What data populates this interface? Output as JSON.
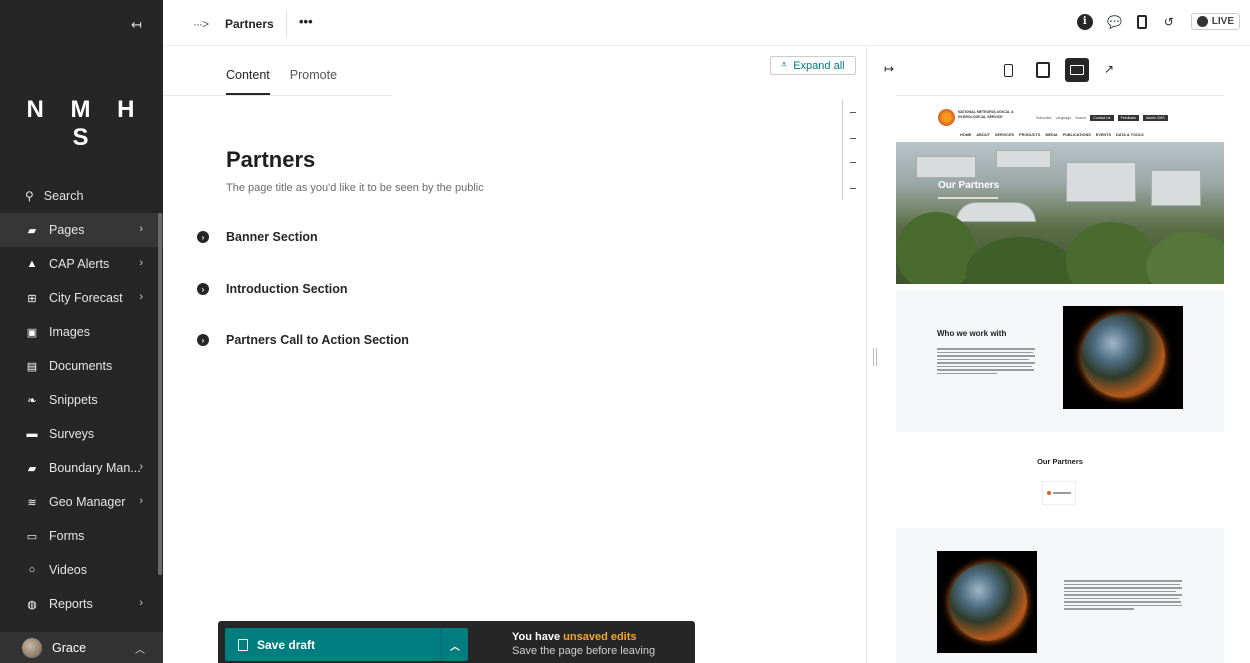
{
  "sidebar": {
    "logo": "N M H S",
    "collapse_icon": "arrow-left-to-line-icon",
    "search_label": "Search",
    "items": [
      {
        "label": "Pages",
        "icon": "folder-open-icon",
        "has_children": true,
        "active": true
      },
      {
        "label": "CAP Alerts",
        "icon": "warning-triangle-icon",
        "has_children": true
      },
      {
        "label": "City Forecast",
        "icon": "table-grid-icon",
        "has_children": true
      },
      {
        "label": "Images",
        "icon": "image-icon",
        "has_children": false
      },
      {
        "label": "Documents",
        "icon": "document-icon",
        "has_children": false
      },
      {
        "label": "Snippets",
        "icon": "snippet-leaf-icon",
        "has_children": false
      },
      {
        "label": "Surveys",
        "icon": "folder-icon",
        "has_children": false
      },
      {
        "label": "Boundary Man...",
        "icon": "folder-open-icon",
        "has_children": true
      },
      {
        "label": "Geo Manager",
        "icon": "layers-icon",
        "has_children": true
      },
      {
        "label": "Forms",
        "icon": "form-icon",
        "has_children": false
      },
      {
        "label": "Videos",
        "icon": "circle-icon",
        "has_children": false
      },
      {
        "label": "Reports",
        "icon": "globe-icon",
        "has_children": true
      }
    ],
    "user": {
      "name": "Grace"
    }
  },
  "header": {
    "breadcrumb_trail": "···>",
    "title": "Partners",
    "more": "•••",
    "live_label": "LIVE"
  },
  "editor": {
    "tabs": [
      {
        "label": "Content",
        "active": true
      },
      {
        "label": "Promote",
        "active": false
      }
    ],
    "expand_all": "Expand all",
    "page_title": "Partners",
    "page_title_help": "The page title as you'd like it to be seen by the public",
    "sections": [
      {
        "label": "Banner Section"
      },
      {
        "label": "Introduction Section"
      },
      {
        "label": "Partners Call to Action Section"
      }
    ]
  },
  "savebar": {
    "button": "Save draft",
    "message_prefix": "You have ",
    "message_highlight": "unsaved edits",
    "message_sub": "Save the page before leaving"
  },
  "preview": {
    "site_name": "NATIONAL METEOROLOGICAL & HYDROLOGICAL SERVICE",
    "util_links": [
      "Subscribe",
      "Language",
      "Search"
    ],
    "util_buttons": [
      "Contact Us",
      "Feedback",
      "Admin CMS"
    ],
    "nav": [
      "HOME",
      "ABOUT",
      "SERVICES",
      "PRODUCTS",
      "MEDIA",
      "PUBLICATIONS",
      "EVENTS",
      "DATA & TOOLS"
    ],
    "hero_title": "Our Partners",
    "intro_heading": "Who we work with",
    "partners_heading": "Our Partners"
  },
  "colors": {
    "sidebar_bg": "#262626",
    "accent_teal": "#007d7e",
    "warning_orange": "#f5a623"
  }
}
